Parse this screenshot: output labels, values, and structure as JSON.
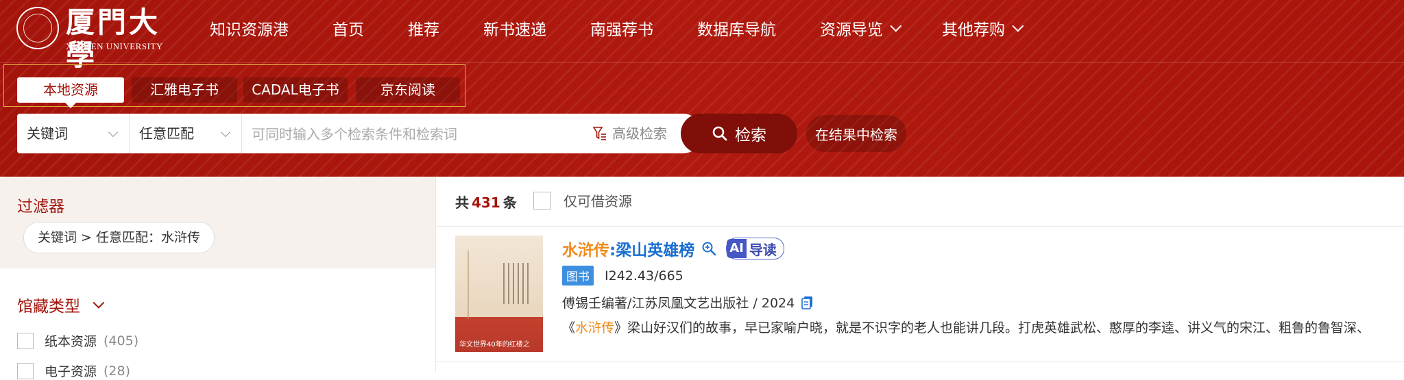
{
  "header": {
    "logo": {
      "cn": "厦門大學",
      "en": "XIAMEN UNIVERSITY"
    },
    "nav": [
      {
        "label": "知识资源港"
      },
      {
        "label": "首页"
      },
      {
        "label": "推荐"
      },
      {
        "label": "新书速递"
      },
      {
        "label": "南强荐书"
      },
      {
        "label": "数据库导航"
      },
      {
        "label": "资源导览",
        "dropdown": true
      },
      {
        "label": "其他荐购",
        "dropdown": true
      }
    ]
  },
  "source_tabs": [
    {
      "label": "本地资源",
      "active": true
    },
    {
      "label": "汇雅电子书"
    },
    {
      "label": "CADAL电子书"
    },
    {
      "label": "京东阅读"
    }
  ],
  "search": {
    "field_select": "关键词",
    "match_select": "任意匹配",
    "placeholder": "可同时输入多个检索条件和检索词",
    "advanced_label": "高级检索",
    "search_button": "检索",
    "within_results_button": "在结果中检索"
  },
  "filters": {
    "title": "过滤器",
    "active_chip": "关键词 > 任意匹配：水浒传",
    "collection": {
      "title": "馆藏类型",
      "options": [
        {
          "label": "纸本资源",
          "count": "(405)"
        },
        {
          "label": "电子资源",
          "count": "(28)"
        }
      ]
    }
  },
  "results": {
    "total_prefix": "共",
    "total": "431",
    "total_suffix": "条",
    "only_available_label": "仅可借资源",
    "items": [
      {
        "title_highlight": "水浒传",
        "title_rest": ":梁山英雄榜",
        "ai_badge_ai": "AI",
        "ai_badge_text": "导读",
        "type": "图书",
        "call_number": "I242.43/665",
        "author_publisher_year": "傅锡壬编著/江苏凤凰文艺出版社 / 2024",
        "desc_prefix": "《",
        "desc_highlight": "水浒传",
        "desc_rest": "》梁山好汉们的故事，早已家喻户晓，就是不识字的老人也能讲几段。打虎英雄武松、憨厚的李逵、讲义气的宋江、粗鲁的鲁智深、",
        "cover_text": "华文世界40年的红楼之"
      }
    ]
  },
  "colors": {
    "header_red": "#a4140b",
    "search_button": "#7f0f08",
    "highlight_orange": "#f08a19",
    "link_blue": "#1a6fd1",
    "ai_purple": "#4657c6"
  }
}
